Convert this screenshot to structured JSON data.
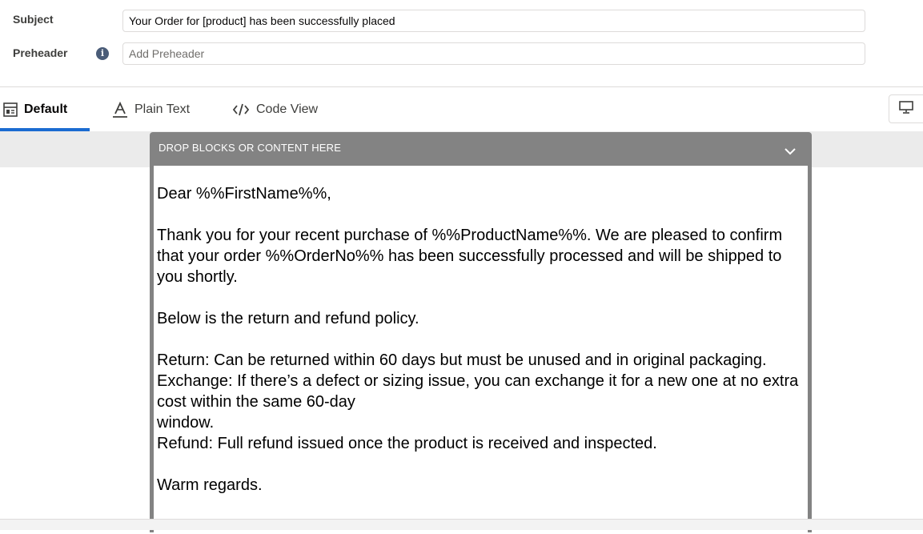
{
  "form": {
    "subject_label": "Subject",
    "subject_value": "Your Order for [product] has been successfully placed",
    "preheader_label": "Preheader",
    "preheader_placeholder": "Add Preheader",
    "info_symbol": "i"
  },
  "tabs": [
    {
      "label": "Default",
      "icon": "layout-icon",
      "active": true
    },
    {
      "label": "Plain Text",
      "icon": "text-a-icon",
      "active": false
    },
    {
      "label": "Code View",
      "icon": "code-icon",
      "active": false
    }
  ],
  "device_toggle": {
    "icon": "desktop-icon"
  },
  "dropzone": {
    "header": "DROP BLOCKS OR CONTENT HERE",
    "icon": "chevron-down-icon"
  },
  "email": {
    "greeting": "Dear %%FirstName%%,",
    "intro": "Thank you for your recent purchase of %%ProductName%%. We are pleased to confirm that your order %%OrderNo%% has been successfully processed and will be shipped to you shortly.",
    "policy_intro": "Below is the return and refund policy.",
    "return_line": "Return: Can be returned within 60 days but must be unused and in original packaging.",
    "exchange_line": "Exchange: If there’s a defect or sizing issue, you can exchange it for a new one at no extra cost within the same 60-day",
    "exchange_cont": "window.",
    "refund_line": "Refund: Full refund issued once the product is received and inspected.",
    "closing": "Warm regards."
  },
  "colors": {
    "accent": "#1b6bd1",
    "dropzone": "#838383",
    "info_icon": "#4a5c78"
  }
}
